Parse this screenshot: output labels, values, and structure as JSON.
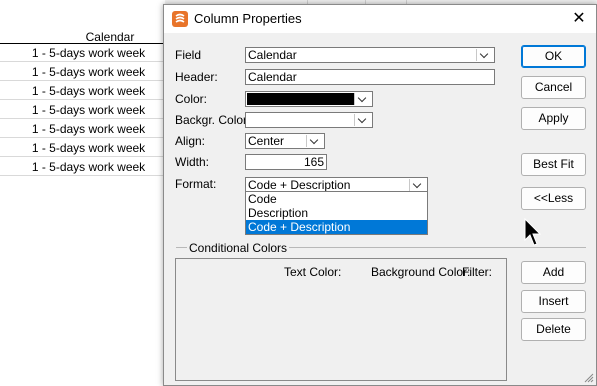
{
  "background": {
    "column_header": "Calendar",
    "rows": [
      "1 - 5-days work week",
      "1 - 5-days work week",
      "1 - 5-days work week",
      "1 - 5-days work week",
      "1 - 5-days work week",
      "1 - 5-days work week",
      "1 - 5-days work week"
    ]
  },
  "dialog": {
    "title": "Column Properties",
    "close_icon": "close-icon",
    "labels": {
      "field": "Field",
      "header": "Header:",
      "color": "Color:",
      "backgr_color": "Backgr. Color:",
      "align": "Align:",
      "width": "Width:",
      "format": "Format:"
    },
    "values": {
      "field": "Calendar",
      "header": "Calendar",
      "color": "#000000",
      "backgr_color": "#ffffff",
      "align": "Center",
      "width": "165",
      "format": "Code + Description"
    },
    "format_options": [
      "Code",
      "Description",
      "Code + Description"
    ],
    "format_selected_index": 2,
    "buttons": {
      "ok": "OK",
      "cancel": "Cancel",
      "apply": "Apply",
      "best_fit": "Best Fit",
      "less": "<<Less",
      "add": "Add",
      "insert": "Insert",
      "delete": "Delete"
    },
    "conditional": {
      "title": "Conditional Colors",
      "text_color": "Text Color:",
      "background_color": "Background Color:",
      "filter": "Filter:"
    }
  },
  "colors": {
    "accent": "#0078d7",
    "app_icon": "#e8742a"
  }
}
